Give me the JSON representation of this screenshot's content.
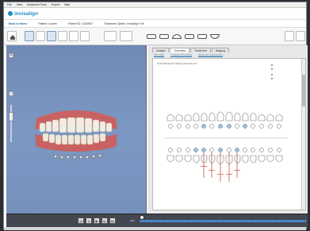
{
  "menu": [
    "File",
    "View",
    "Advanced Tools",
    "Export",
    "Help"
  ],
  "app": {
    "logo": "invisalign"
  },
  "patient_bar": {
    "back": "Back to Home",
    "patient": "Patient: Lauren",
    "submission": "Patient ID: 1234567",
    "treatment": "Treatment Option: Invisalign Full"
  },
  "tabs": [
    "Images",
    "Overview",
    "Treatment",
    "Staging"
  ],
  "subtabs": [
    "Tab Chart",
    "Treatment Overview",
    "Movement Assessment"
  ],
  "chart": {
    "title": "Tooth Movement Staging Assessment"
  },
  "playback": {
    "stage": "0/20"
  }
}
